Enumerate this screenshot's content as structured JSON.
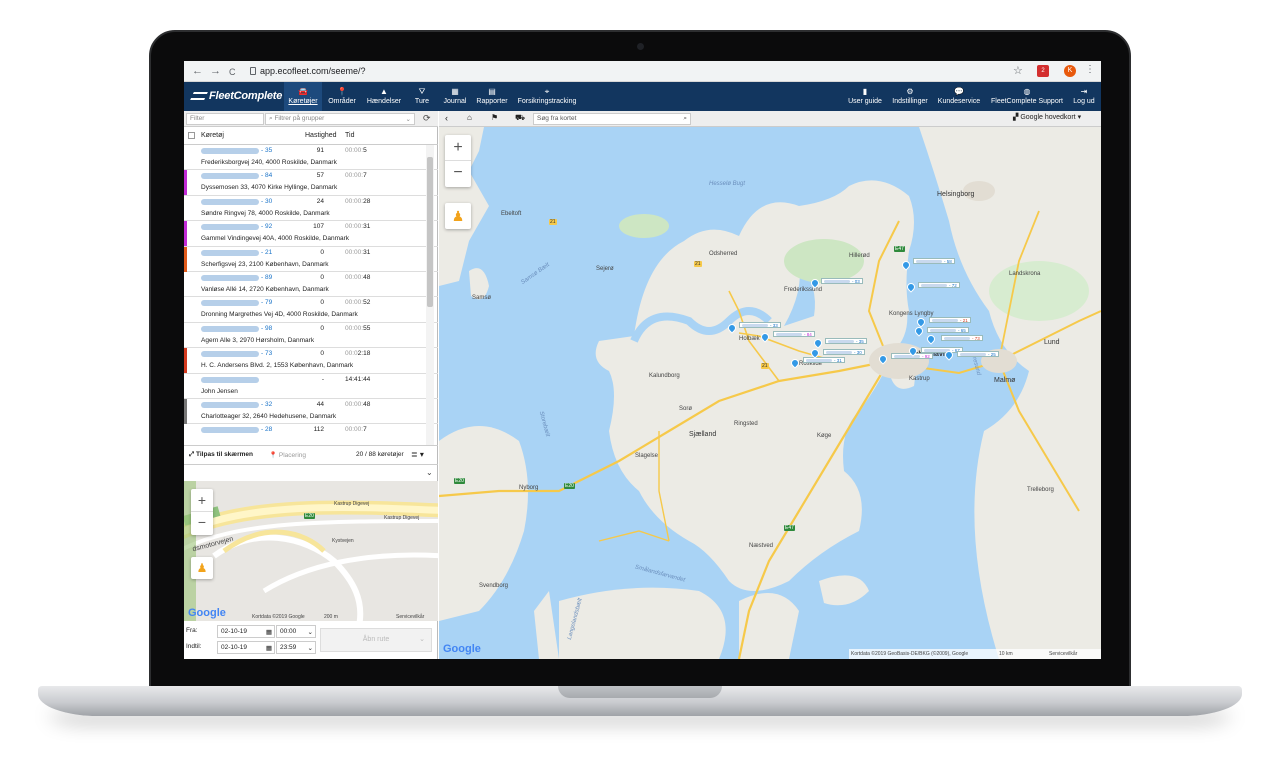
{
  "browser": {
    "url": "app.ecofleet.com/seeme/?",
    "nav_back": "←",
    "nav_fwd": "→",
    "nav_reload": "C",
    "ext_badge": "2",
    "profile_initial": "K"
  },
  "app": {
    "logo": "FleetComplete",
    "tabs": [
      {
        "label": "Køretøjer",
        "icon": "car-icon"
      },
      {
        "label": "Områder",
        "icon": "pin-icon"
      },
      {
        "label": "Hændelser",
        "icon": "warning-icon"
      },
      {
        "label": "Ture",
        "icon": "road-icon"
      },
      {
        "label": "Journal",
        "icon": "calendar-icon"
      },
      {
        "label": "Rapporter",
        "icon": "document-icon"
      },
      {
        "label": "Forsikringstracking",
        "icon": "crosshair-icon"
      }
    ],
    "right_tabs": [
      {
        "label": "User guide",
        "icon": "book-icon"
      },
      {
        "label": "Indstillinger",
        "icon": "gear-icon"
      },
      {
        "label": "Kundeservice",
        "icon": "chat-icon"
      },
      {
        "label": "FleetComplete Support",
        "icon": "user-icon"
      },
      {
        "label": "Log ud",
        "icon": "logout-icon"
      }
    ]
  },
  "left": {
    "filter_placeholder": "Filter",
    "group_placeholder": "Filtrer på grupper",
    "col_vehicle": "Køretøj",
    "col_speed": "Hastighed",
    "col_time": "Tid",
    "rows": [
      {
        "num": "- 35",
        "speed": "91",
        "time_pre": "00:00:",
        "time_post": "5",
        "addr": "Frederiksborgvej 240, 4000 Roskilde, Danmark",
        "color": ""
      },
      {
        "num": "- 84",
        "speed": "57",
        "time_pre": "00:00:",
        "time_post": "7",
        "addr": "Dyssemosen 33, 4070 Kirke Hyllinge, Danmark",
        "color": "#c22bd6"
      },
      {
        "num": "- 30",
        "speed": "24",
        "time_pre": "00:00:",
        "time_post": "28",
        "addr": "Søndre Ringvej 78, 4000 Roskilde, Danmark",
        "color": ""
      },
      {
        "num": "- 92",
        "speed": "107",
        "time_pre": "00:00:",
        "time_post": "31",
        "addr": "Gammel Vindingevej 40A, 4000 Roskilde, Danmark",
        "color": "#c22bd6"
      },
      {
        "num": "- 21",
        "speed": "0",
        "time_pre": "00:00:",
        "time_post": "31",
        "addr": "Scherfigsvej 23, 2100 København, Danmark",
        "color": "#e05a1a"
      },
      {
        "num": "- 89",
        "speed": "0",
        "time_pre": "00:00:",
        "time_post": "48",
        "addr": "Vanløse Allé 14, 2720 København, Danmark",
        "color": ""
      },
      {
        "num": "- 79",
        "speed": "0",
        "time_pre": "00:00:",
        "time_post": "52",
        "addr": "Dronning Margrethes Vej 4D, 4000 Roskilde, Danmark",
        "color": ""
      },
      {
        "num": "- 98",
        "speed": "0",
        "time_pre": "00:00:",
        "time_post": "55",
        "addr": "Agern Alle 3, 2970 Hørsholm, Danmark",
        "color": ""
      },
      {
        "num": "- 73",
        "speed": "0",
        "time_pre": "00:0",
        "time_post": "2:18",
        "addr": "H. C. Andersens Blvd. 2, 1553 København, Danmark",
        "color": "#d33a1f"
      },
      {
        "num": "",
        "speed": "-",
        "time_pre": "",
        "time_post": "14:41:44",
        "addr": "John Jensen",
        "color": ""
      },
      {
        "num": "- 32",
        "speed": "44",
        "time_pre": "00:00:",
        "time_post": "48",
        "addr": "Charlotteager 32, 2640 Hedehusene, Danmark",
        "color": "#777"
      },
      {
        "num": "- 28",
        "speed": "112",
        "time_pre": "00:00:",
        "time_post": "7",
        "addr": "",
        "color": ""
      }
    ],
    "fit_label": "Tilpas til skærmen",
    "placement_label": "Placering",
    "count_label": "20 / 88 køretøjer",
    "minimap": {
      "road1": "Kastrup Digevej",
      "road2": "Kastrup Digevej",
      "road3": "Kystvejen",
      "motorway": "dsmotorvejen",
      "copyright": "Kortdata ©2019 Google",
      "scale": "200 m",
      "terms": "Servicevilkår",
      "eroad": "E20"
    },
    "from_label": "Fra:",
    "to_label": "Indtil:",
    "from_date": "02-10-19",
    "from_time": "00:00",
    "to_date": "02-10-19",
    "to_time": "23:59",
    "open_route": "Åbn rute"
  },
  "map": {
    "search_placeholder": "Søg fra kortet",
    "map_type": "Google hovedkort",
    "copyright": "Kortdata ©2019 GeoBasis-DE/BKG (©2009), Google",
    "scale": "10 km",
    "terms": "Servicevilkår",
    "google": "Google",
    "labels": {
      "helsingborg": "Helsingborg",
      "hillerod": "Hillerød",
      "frederikssund": "Frederikssund",
      "kongens_lyngby": "Kongens Lyngby",
      "kobenhavn": "København",
      "malmo": "Malmø",
      "lund": "Lund",
      "roskilde": "Roskilde",
      "holbaek": "Holbæk",
      "kalundborg": "Kalundborg",
      "slagelse": "Slagelse",
      "naestved": "Næstved",
      "koge": "Køge",
      "ringsted": "Ringsted",
      "nyborg": "Nyborg",
      "svendborg": "Svendborg",
      "trelleborg": "Trelleborg",
      "kastrup": "Kastrup",
      "landskrona": "Landskrona",
      "sjaelland": "Sjælland",
      "sorø": "Sorø",
      "ebeltoft": "Ebeltoft",
      "samso": "Samsø",
      "sejero": "Sejerø",
      "odsherred": "Odsherred",
      "kattegat": "Hesselø Bugt",
      "samsobaelt": "Samsø Bælt",
      "storebaelt": "Storebælt",
      "smalandsfarvandet": "Smålandsfarvandet",
      "langelandsbaelt": "Langelandsbælt",
      "oresund": "Øresund"
    },
    "pin_labels": [
      "- 58",
      "- 72",
      "- 03",
      "- 33",
      "- 84",
      "- 35",
      "- 31",
      "- 30",
      "- 92",
      "- 21",
      "- 73",
      "- 67",
      "- 25",
      "- 65"
    ]
  }
}
